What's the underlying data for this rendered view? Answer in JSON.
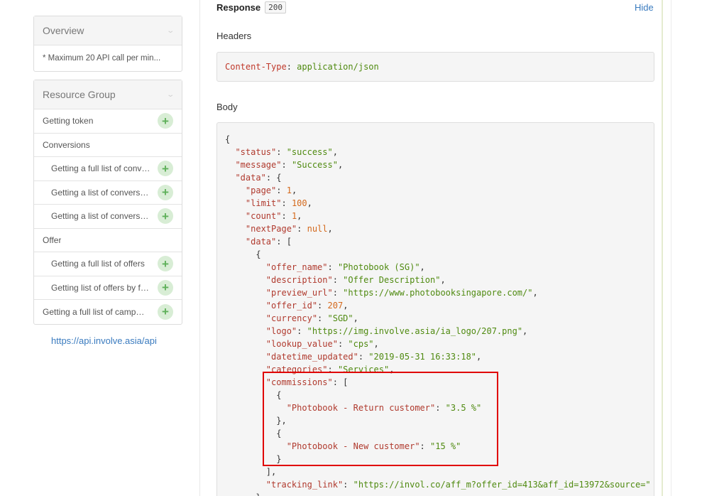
{
  "sidebar": {
    "overview": {
      "title": "Overview",
      "note": "* Maximum 20 API call per min..."
    },
    "resource_group": {
      "title": "Resource Group",
      "items": [
        {
          "label": "Getting token",
          "sub": false,
          "addable": true
        },
        {
          "label": "Conversions",
          "sub": false,
          "addable": false
        },
        {
          "label": "Getting a full list of conve...",
          "sub": true,
          "addable": true
        },
        {
          "label": "Getting a list of conversio...",
          "sub": true,
          "addable": true
        },
        {
          "label": "Getting a list of conversio...",
          "sub": true,
          "addable": true
        },
        {
          "label": "Offer",
          "sub": false,
          "addable": false
        },
        {
          "label": "Getting a full list of offers",
          "sub": true,
          "addable": true
        },
        {
          "label": "Getting list of offers by fil...",
          "sub": true,
          "addable": true
        },
        {
          "label": "Getting a full list of campai...",
          "sub": false,
          "addable": true
        }
      ]
    },
    "api_url": "https://api.involve.asia/api"
  },
  "response": {
    "title": "Response",
    "status_code": "200",
    "hide_label": "Hide",
    "headers_label": "Headers",
    "header_key": "Content-Type",
    "header_value": "application/json",
    "body_label": "Body",
    "body_lines": [
      [
        [
          "p",
          "{"
        ]
      ],
      [
        [
          "p",
          "  "
        ],
        [
          "k",
          "\"status\""
        ],
        [
          "p",
          ": "
        ],
        [
          "s",
          "\"success\""
        ],
        [
          "p",
          ","
        ]
      ],
      [
        [
          "p",
          "  "
        ],
        [
          "k",
          "\"message\""
        ],
        [
          "p",
          ": "
        ],
        [
          "s",
          "\"Success\""
        ],
        [
          "p",
          ","
        ]
      ],
      [
        [
          "p",
          "  "
        ],
        [
          "k",
          "\"data\""
        ],
        [
          "p",
          ": {"
        ]
      ],
      [
        [
          "p",
          "    "
        ],
        [
          "k",
          "\"page\""
        ],
        [
          "p",
          ": "
        ],
        [
          "n",
          "1"
        ],
        [
          "p",
          ","
        ]
      ],
      [
        [
          "p",
          "    "
        ],
        [
          "k",
          "\"limit\""
        ],
        [
          "p",
          ": "
        ],
        [
          "n",
          "100"
        ],
        [
          "p",
          ","
        ]
      ],
      [
        [
          "p",
          "    "
        ],
        [
          "k",
          "\"count\""
        ],
        [
          "p",
          ": "
        ],
        [
          "n",
          "1"
        ],
        [
          "p",
          ","
        ]
      ],
      [
        [
          "p",
          "    "
        ],
        [
          "k",
          "\"nextPage\""
        ],
        [
          "p",
          ": "
        ],
        [
          "n",
          "null"
        ],
        [
          "p",
          ","
        ]
      ],
      [
        [
          "p",
          "    "
        ],
        [
          "k",
          "\"data\""
        ],
        [
          "p",
          ": ["
        ]
      ],
      [
        [
          "p",
          "      {"
        ]
      ],
      [
        [
          "p",
          "        "
        ],
        [
          "k",
          "\"offer_name\""
        ],
        [
          "p",
          ": "
        ],
        [
          "s",
          "\"Photobook (SG)\""
        ],
        [
          "p",
          ","
        ]
      ],
      [
        [
          "p",
          "        "
        ],
        [
          "k",
          "\"description\""
        ],
        [
          "p",
          ": "
        ],
        [
          "s",
          "\"Offer Description\""
        ],
        [
          "p",
          ","
        ]
      ],
      [
        [
          "p",
          "        "
        ],
        [
          "k",
          "\"preview_url\""
        ],
        [
          "p",
          ": "
        ],
        [
          "s",
          "\"https://www.photobooksingapore.com/\""
        ],
        [
          "p",
          ","
        ]
      ],
      [
        [
          "p",
          "        "
        ],
        [
          "k",
          "\"offer_id\""
        ],
        [
          "p",
          ": "
        ],
        [
          "n",
          "207"
        ],
        [
          "p",
          ","
        ]
      ],
      [
        [
          "p",
          "        "
        ],
        [
          "k",
          "\"currency\""
        ],
        [
          "p",
          ": "
        ],
        [
          "s",
          "\"SGD\""
        ],
        [
          "p",
          ","
        ]
      ],
      [
        [
          "p",
          "        "
        ],
        [
          "k",
          "\"logo\""
        ],
        [
          "p",
          ": "
        ],
        [
          "s",
          "\"https://img.involve.asia/ia_logo/207.png\""
        ],
        [
          "p",
          ","
        ]
      ],
      [
        [
          "p",
          "        "
        ],
        [
          "k",
          "\"lookup_value\""
        ],
        [
          "p",
          ": "
        ],
        [
          "s",
          "\"cps\""
        ],
        [
          "p",
          ","
        ]
      ],
      [
        [
          "p",
          "        "
        ],
        [
          "k",
          "\"datetime_updated\""
        ],
        [
          "p",
          ": "
        ],
        [
          "s",
          "\"2019-05-31 16:33:18\""
        ],
        [
          "p",
          ","
        ]
      ],
      [
        [
          "p",
          "        "
        ],
        [
          "k",
          "\"categories\""
        ],
        [
          "p",
          ": "
        ],
        [
          "s",
          "\"Services\""
        ],
        [
          "p",
          ","
        ]
      ],
      [
        [
          "p",
          "        "
        ],
        [
          "k",
          "\"commissions\""
        ],
        [
          "p",
          ": ["
        ]
      ],
      [
        [
          "p",
          "          {"
        ]
      ],
      [
        [
          "p",
          "            "
        ],
        [
          "k",
          "\"Photobook - Return customer\""
        ],
        [
          "p",
          ": "
        ],
        [
          "s",
          "\"3.5 %\""
        ]
      ],
      [
        [
          "p",
          "          },"
        ]
      ],
      [
        [
          "p",
          "          {"
        ]
      ],
      [
        [
          "p",
          "            "
        ],
        [
          "k",
          "\"Photobook - New customer\""
        ],
        [
          "p",
          ": "
        ],
        [
          "s",
          "\"15 %\""
        ]
      ],
      [
        [
          "p",
          "          }"
        ]
      ],
      [
        [
          "p",
          "        ],"
        ]
      ],
      [
        [
          "p",
          "        "
        ],
        [
          "k",
          "\"tracking_link\""
        ],
        [
          "p",
          ": "
        ],
        [
          "s",
          "\"https://invol.co/aff_m?offer_id=413&aff_id=13972&source=\""
        ]
      ],
      [
        [
          "p",
          "      }"
        ]
      ]
    ]
  },
  "colors": {
    "highlight": "#e00000",
    "link": "#3a7bbf",
    "json_key": "#b03a2e",
    "json_string": "#4f8a10",
    "json_number": "#d4691c"
  }
}
